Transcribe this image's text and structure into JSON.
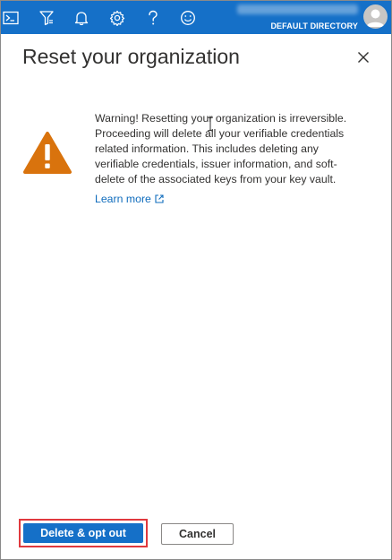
{
  "topbar": {
    "icons": [
      "cloud-shell-icon",
      "directory-filter-icon",
      "notifications-bell-icon",
      "settings-gear-icon",
      "help-question-icon",
      "feedback-smiley-icon"
    ],
    "directory_label": "DEFAULT DIRECTORY"
  },
  "panel": {
    "title": "Reset your organization",
    "warning_text": "Warning! Resetting your organization is irreversible. Proceeding will delete all your verifiable credentials related information. This includes deleting any verifiable credentials, issuer information, and soft-delete of the associated keys from your key vault.",
    "learn_more": "Learn more"
  },
  "footer": {
    "primary_label": "Delete & opt out",
    "secondary_label": "Cancel"
  },
  "colors": {
    "topbar": "#1570c8",
    "warning": "#d9730d",
    "link": "#0f6cbd",
    "highlight": "#e0393e"
  }
}
